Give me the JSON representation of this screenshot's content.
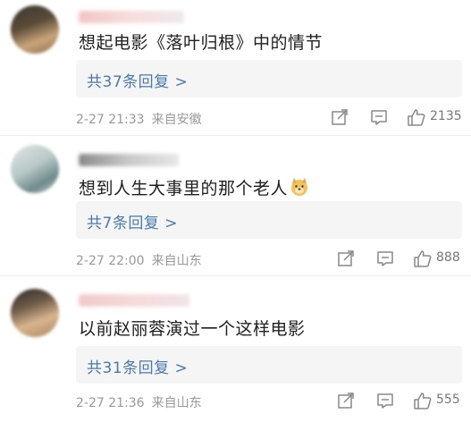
{
  "comments": [
    {
      "text": "想起电影《落叶归根》中的情节",
      "replies": "共37条回复 >",
      "date": "2-27 21:33",
      "location": "来自安徽",
      "likes": "2135",
      "icons": [
        "share-icon",
        "comment-icon",
        "like-icon"
      ]
    },
    {
      "text": "想到人生大事里的那个老人",
      "emoji": "doge-emoji",
      "replies": "共7条回复 >",
      "date": "2-27 22:00",
      "location": "来自山东",
      "likes": "888",
      "icons": [
        "share-icon",
        "comment-icon",
        "like-icon"
      ]
    },
    {
      "text": "以前赵丽蓉演过一个这样电影",
      "replies": "共31条回复 >",
      "date": "2-27 21:36",
      "location": "来自山东",
      "likes": "555",
      "icons": [
        "share-icon",
        "comment-icon",
        "like-icon"
      ]
    }
  ],
  "colors": {
    "reply_link": "#4a79b0",
    "meta": "#999999",
    "text": "#202020",
    "reply_bg": "#f5f5f5"
  }
}
